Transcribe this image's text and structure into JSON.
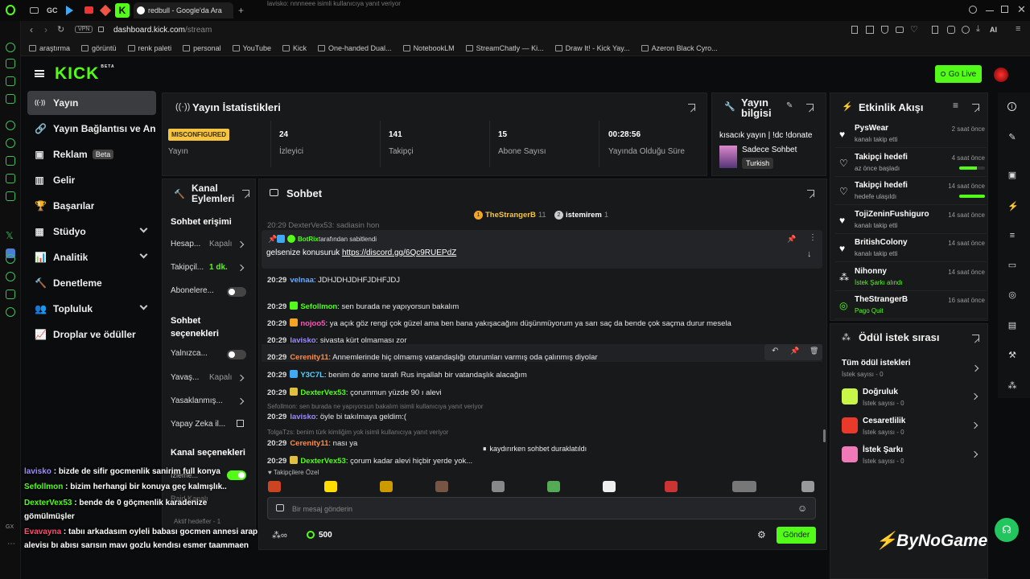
{
  "browser": {
    "tab_title": "redbull - Google'da Ara",
    "url_host": "dashboard.kick.com",
    "url_path": "/stream",
    "vpn_label": "VPN",
    "ai_label": "AI",
    "gc_label": "GC"
  },
  "bookmarks": [
    "araştırma",
    "görüntü",
    "renk paleti",
    "personal",
    "YouTube",
    "Kick",
    "One-handed Dual...",
    "NotebookLM",
    "StreamChatly — Ki...",
    "Draw It! - Kick Yay...",
    "Azeron Black Cyro..."
  ],
  "header": {
    "logo": "KICK",
    "logo_badge": "BETA",
    "go_live_label": "Go Live"
  },
  "nav": {
    "items": [
      {
        "label": "Yayın",
        "icon": "broadcast-icon"
      },
      {
        "label": "Yayın Bağlantısı ve Anahtar",
        "icon": "link-icon"
      },
      {
        "label": "Reklam",
        "icon": "ad-icon",
        "badge": "Beta"
      },
      {
        "label": "Gelir",
        "icon": "revenue-icon"
      },
      {
        "label": "Başarılar",
        "icon": "trophy-icon"
      },
      {
        "label": "Stüdyo",
        "icon": "studio-icon"
      },
      {
        "label": "Analitik",
        "icon": "analytics-icon"
      },
      {
        "label": "Denetleme",
        "icon": "hammer-icon"
      },
      {
        "label": "Topluluk",
        "icon": "community-icon"
      },
      {
        "label": "Droplar ve ödüller",
        "icon": "drops-icon"
      }
    ]
  },
  "stats": {
    "title": "Yayın İstatistikleri",
    "items": [
      {
        "value": "MISCONFIGURED",
        "label": "Yayın"
      },
      {
        "value": "24",
        "label": "İzleyici"
      },
      {
        "value": "141",
        "label": "Takipçi"
      },
      {
        "value": "15",
        "label": "Abone Sayısı"
      },
      {
        "value": "00:28:56",
        "label": "Yayında Olduğu Süre"
      }
    ]
  },
  "stream_info": {
    "title": "Yayın bilgisi",
    "stream_title": "kısacık yayın | !dc !donate",
    "category": "Sadece Sohbet",
    "tag": "Turkish"
  },
  "activity": {
    "title": "Etkinlik Akışı",
    "events": [
      {
        "name": "PysWear",
        "sub": "kanalı takip etti",
        "time": "2 saat önce",
        "progress": null
      },
      {
        "name": "Takipçi hedefi",
        "sub": "az önce başladı",
        "time": "4 saat önce",
        "progress": 0.7
      },
      {
        "name": "Takipçi hedefi",
        "sub": "hedefe ulaşıldı",
        "time": "14 saat önce",
        "progress": 1.0
      },
      {
        "name": "TojiZeninFushiguro",
        "sub": "kanalı takip etti",
        "time": "14 saat önce",
        "progress": null
      },
      {
        "name": "BritishColony",
        "sub": "kanalı takip etti",
        "time": "14 saat önce",
        "progress": null
      },
      {
        "name": "Nihonny",
        "sub": "İstek Şarkı alındı",
        "time": "14 saat önce",
        "progress": null
      },
      {
        "name": "TheStrangerB",
        "sub": "Pago Quit",
        "time": "16 saat önce",
        "progress": null
      }
    ]
  },
  "rewards": {
    "title": "Ödül istek sırası",
    "all_label": "Tüm ödül istekleri",
    "all_count": "İstek sayısı - 0",
    "items": [
      {
        "name": "Doğruluk",
        "count": "İstek sayısı - 0",
        "color": "#c8f547"
      },
      {
        "name": "Cesaretlilik",
        "count": "İstek sayısı - 0",
        "color": "#e8392a"
      },
      {
        "name": "İstek Şarkı",
        "count": "İstek sayısı - 0",
        "color": "#f07ab8"
      }
    ]
  },
  "channel_actions": {
    "title": "Kanal Eylemleri",
    "chat_access": "Sohbet erişimi",
    "rows": [
      {
        "label": "Hesap...",
        "value": "Kapalı"
      },
      {
        "label": "Takipçil...",
        "value": "1 dk."
      },
      {
        "label": "Abonelere...",
        "value": ""
      }
    ],
    "chat_options": "Sohbet seçenekleri",
    "opt_rows": [
      {
        "label": "Yalnızca...",
        "value": ""
      },
      {
        "label": "Yavaş...",
        "value": "Kapalı"
      },
      {
        "label": "Yasaklanmış...",
        "value": ""
      },
      {
        "label": "Yapay Zeka il...",
        "value": ""
      }
    ],
    "channel_options": "Kanal seçenekleri",
    "izleme": "İzleme...",
    "active_goals": "Aktif hedefler - 1",
    "raid": "Raid Kanalı"
  },
  "chat": {
    "title": "Sohbet",
    "top_chatters": [
      {
        "rank": "1",
        "name": "TheStrangerB",
        "count": "11"
      },
      {
        "rank": "2",
        "name": "istemirem",
        "count": "1"
      }
    ],
    "pinned_by": "tarafından sabitlendi",
    "pinned_user": "BotRix",
    "pinned_text": "gelsenize konusuruk ",
    "pinned_link": "https://discord.gg/6Qc9RUEPdZ",
    "messages": [
      {
        "time": "20:29",
        "user": "velnaa",
        "color": "#6aa9ff",
        "text": "JDHJDHJDHFJDHFJDJ",
        "reply": null
      },
      {
        "time": "20:29",
        "user": "Sefollmon",
        "color": "#53fc18",
        "text": "sen burada ne yapıyorsun bakalım",
        "reply": "lavisko: nnnneee isimli kullanıcıya yanıt veriyor"
      },
      {
        "time": "20:29",
        "user": "nojoo5",
        "color": "#f25bb1",
        "text": "ya açık göz rengi çok güzel ama ben bana yakışacağını düşünmüyorum ya sarı saç da bende çok saçma durur mesela",
        "reply": null
      },
      {
        "time": "20:29",
        "user": "lavisko",
        "color": "#9b8cff",
        "text": "sivasta kürt olmaması zor",
        "reply": null
      },
      {
        "time": "20:29",
        "user": "Cerenity11",
        "color": "#ff8c42",
        "text": "Annemlerinde hiç olmamış vatandaşlığı oturumları varmış oda çalınmış diyolar",
        "reply": null
      },
      {
        "time": "20:29",
        "user": "Y3C7L",
        "color": "#5ad1ff",
        "text": "benim de anne tarafı Rus inşallah bir vatandaşlık alacağım",
        "reply": null
      },
      {
        "time": "20:29",
        "user": "DexterVex53",
        "color": "#53fc18",
        "text": "çorummun yüzde 90 ı alevi",
        "reply": null
      },
      {
        "time": "20:29",
        "user": "lavisko",
        "color": "#9b8cff",
        "text": "öyle bi takılmaya geldim:(",
        "reply": "Sefollmon: sen burada ne yapıyorsun bakalım isimli kullanıcıya yanıt veriyor"
      },
      {
        "time": "20:29",
        "user": "Cerenity11",
        "color": "#ff8c42",
        "text": "nası ya",
        "reply": "TolgaTzs: benim türk kimliğim yok isimli kullanıcıya yanıt veriyor"
      },
      {
        "time": "20:29",
        "user": "DexterVex53",
        "color": "#53fc18",
        "text": "çorum kadar alevi hiçbir yerde yok...",
        "reply": null
      }
    ],
    "top_cut": "20:29  DexterVex53: sadiasin hon",
    "paused": "kaydırırken sohbet duraklatıldı",
    "follower_only": "Takipçilere Özel",
    "input_placeholder": "Bir mesaj gönderin",
    "points": "500",
    "send_label": "Gönder"
  },
  "overlay": {
    "messages": [
      {
        "user": "lavisko",
        "color": "#9b8cff",
        "text": "bizde de sifir gocmenlik sanirim full konya"
      },
      {
        "user": "Sefollmon",
        "color": "#53fc18",
        "text": "bizim herhangi bir konuya geç kalmışlık.."
      },
      {
        "user": "DexterVex53",
        "color": "#53fc18",
        "text": "bende de 0 göçmenlik karadenize"
      },
      {
        "user": "",
        "color": "#ffffff",
        "text": "gömülmüşler"
      },
      {
        "user": "Evavayna",
        "color": "#ff4d6d",
        "text": "tabıı arkadasım oyleli babası gocmen annesi arap"
      },
      {
        "user": "",
        "color": "#ffffff",
        "text": "alevisı bı abısı sarısın mavı gozlu kendısı esmer taammaen"
      }
    ],
    "watermark": "ByNoGame",
    "gx_label": "GX"
  },
  "colors": {
    "accent": "#53fc18",
    "panel": "#18191b",
    "bg": "#0b0c0d"
  }
}
